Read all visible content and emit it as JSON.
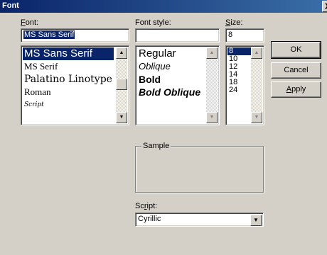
{
  "window": {
    "title": "Font",
    "close_glyph": "X"
  },
  "font": {
    "label_accel": "F",
    "label_rest": "ont:",
    "value": "MS Sans Serif",
    "items": [
      {
        "label": "MS Sans Serif",
        "family": "\"Liberation Sans\", sans-serif",
        "size": 15,
        "style": "normal",
        "weight": "normal",
        "selected": true
      },
      {
        "label": "MS Serif",
        "family": "\"Liberation Serif\", serif",
        "size": 13,
        "style": "normal",
        "weight": "normal",
        "selected": false
      },
      {
        "label": "Palatino Linotype",
        "family": "\"DejaVu Serif\", serif",
        "size": 14,
        "style": "normal",
        "weight": "normal",
        "selected": false
      },
      {
        "label": "Roman",
        "family": "\"Liberation Serif\", serif",
        "size": 13,
        "style": "normal",
        "weight": "normal",
        "selected": false
      },
      {
        "label": "Script",
        "family": "\"DejaVu Serif\", serif",
        "size": 9,
        "style": "italic",
        "weight": "normal",
        "selected": false
      }
    ]
  },
  "font_style": {
    "label": "Font style:",
    "value": "",
    "items": [
      {
        "label": "Regular",
        "family": "\"Liberation Sans\", sans-serif",
        "size": 15,
        "style": "normal",
        "weight": "normal"
      },
      {
        "label": "Oblique",
        "family": "\"Liberation Sans\", sans-serif",
        "size": 13,
        "style": "italic",
        "weight": "normal"
      },
      {
        "label": "Bold",
        "family": "\"Liberation Sans\", sans-serif",
        "size": 14,
        "style": "normal",
        "weight": "bold"
      },
      {
        "label": "Bold Oblique",
        "family": "\"Liberation Sans\", sans-serif",
        "size": 14,
        "style": "italic",
        "weight": "bold"
      }
    ]
  },
  "size": {
    "label_accel": "S",
    "label_rest": "ize:",
    "value": "8",
    "items": [
      "8",
      "10",
      "12",
      "14",
      "18",
      "24"
    ],
    "selected": "8"
  },
  "buttons": {
    "ok": "OK",
    "cancel": "Cancel",
    "apply_accel": "A",
    "apply_rest": "pply"
  },
  "sample": {
    "label": "Sample"
  },
  "script": {
    "label_pre": "Sc",
    "label_accel": "r",
    "label_post": "ipt:",
    "value": "Cyrillic"
  },
  "icons": {
    "scroll_up": "up-arrow-icon",
    "scroll_down": "down-arrow-icon",
    "dropdown": "dropdown-arrow-icon"
  }
}
